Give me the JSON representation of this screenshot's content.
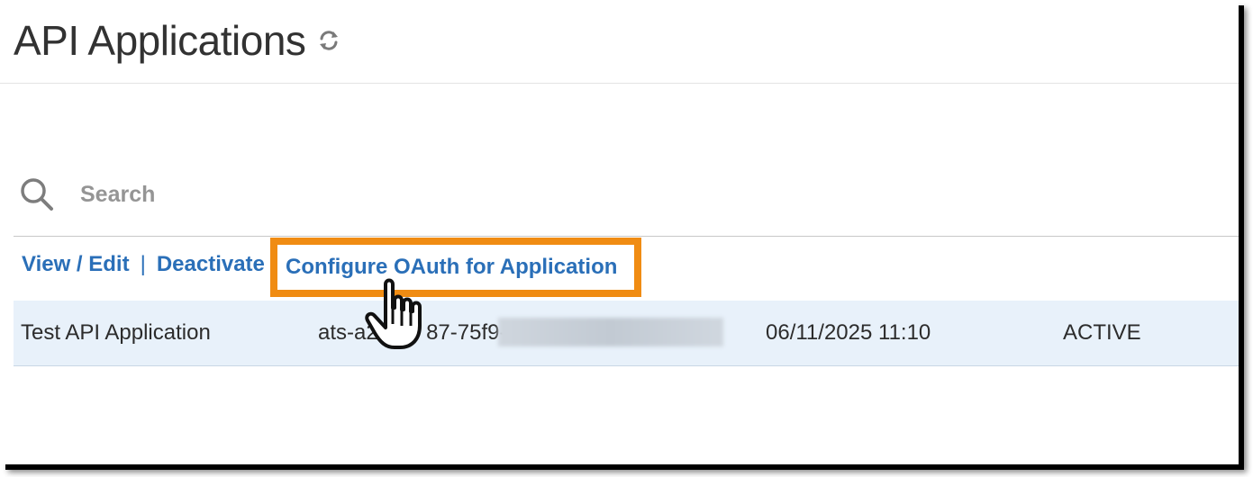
{
  "page": {
    "title": "API Applications",
    "refresh_icon": "refresh-icon"
  },
  "search": {
    "placeholder": "Search",
    "icon": "search-icon"
  },
  "actions": {
    "view_edit": "View / Edit",
    "separator": "|",
    "deactivate": "Deactivate",
    "configure_oauth": "Configure OAuth for Application",
    "highlight_color": "#f08c13",
    "link_color": "#2a6fb8"
  },
  "table": {
    "rows": [
      {
        "name": "Test API Application",
        "key": "ats-a22",
        "key_part2": "87-75f9-",
        "created": "06/11/2025 11:10",
        "status": "ACTIVE"
      }
    ],
    "row_selected_color": "#e8f1fa"
  },
  "cursor": {
    "icon": "hand-pointer-icon"
  }
}
